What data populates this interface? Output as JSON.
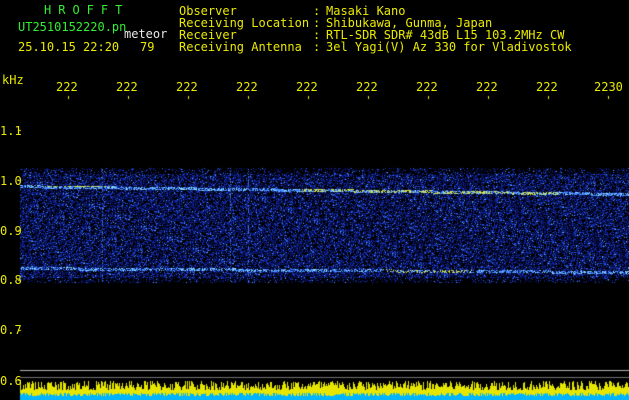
{
  "header": {
    "brand": "HROFFT",
    "filename": "UT2510152220.pn",
    "mode": "meteor",
    "datetime": "25.10.15 22:20",
    "count": "79"
  },
  "info": {
    "observer_label": "Observer",
    "observer_value": "Masaki Kano",
    "location_label": "Receiving Location",
    "location_value": "Shibukawa, Gunma, Japan",
    "receiver_label": "Receiver",
    "receiver_value": "RTL-SDR SDR# 43dB L15 103.2MHz CW",
    "antenna_label": "Receiving Antenna",
    "antenna_value": "3el Yagi(V) Az 330 for Vladivostok"
  },
  "axes": {
    "unit": "kHz",
    "x_ticks": [
      "222",
      "222",
      "222",
      "222",
      "222",
      "222",
      "222",
      "222",
      "222",
      "2230"
    ],
    "y_ticks": [
      "1.1",
      "1.0",
      "0.9",
      "0.8",
      "0.7",
      "0.6"
    ]
  },
  "colors": {
    "background": "#000000",
    "label_yellow": "#eaea00",
    "brand_green": "#33ee33",
    "waterfall_low": "#0b1e8a",
    "waterfall_mid": "#2f6cff",
    "waterfall_high": "#e8f23a",
    "level_bars_yellow": "#e6e600",
    "level_bars_cyan": "#00b4ff"
  }
}
